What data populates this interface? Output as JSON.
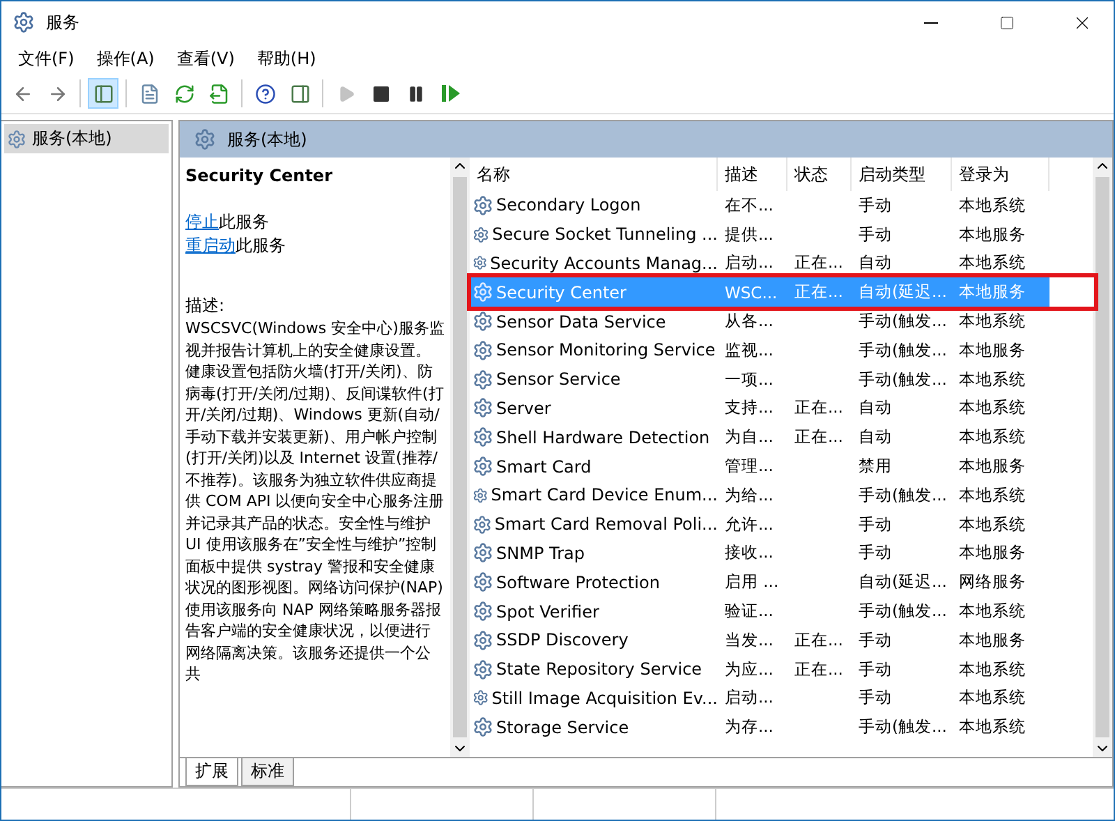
{
  "window": {
    "title": "服务"
  },
  "menu": [
    "文件(F)",
    "操作(A)",
    "查看(V)",
    "帮助(H)"
  ],
  "toolbar": [
    {
      "kind": "back",
      "disabled": false,
      "selected": false
    },
    {
      "kind": "forward",
      "disabled": false,
      "selected": false
    },
    {
      "kind": "tree",
      "disabled": false,
      "selected": true
    },
    {
      "kind": "sheet",
      "disabled": false,
      "selected": false
    },
    {
      "kind": "refresh",
      "disabled": false,
      "selected": false
    },
    {
      "kind": "export",
      "disabled": false,
      "selected": false
    },
    {
      "kind": "help",
      "disabled": false,
      "selected": false
    },
    {
      "kind": "pane",
      "disabled": false,
      "selected": false
    },
    {
      "kind": "play",
      "disabled": true,
      "selected": false
    },
    {
      "kind": "stop",
      "disabled": false,
      "selected": false
    },
    {
      "kind": "pause",
      "disabled": false,
      "selected": false
    },
    {
      "kind": "resume",
      "disabled": false,
      "selected": false
    }
  ],
  "tree": [
    {
      "label": "服务(本地)",
      "selected": true
    }
  ],
  "pane_header": "服务(本地)",
  "details": {
    "title": "Security Center",
    "actions": [
      {
        "link": "停止",
        "text": "此服务"
      },
      {
        "link": "重启动",
        "text": "此服务"
      }
    ],
    "description_label": "描述:",
    "description": "WSCSVC(Windows 安全中心)服务监视并报告计算机上的安全健康设置。健康设置包括防火墙(打开/关闭)、防病毒(打开/关闭/过期)、反间谍软件(打开/关闭/过期)、Windows 更新(自动/手动下载并安装更新)、用户帐户控制(打开/关闭)以及 Internet 设置(推荐/不推荐)。该服务为独立软件供应商提供 COM API 以便向安全中心服务注册并记录其产品的状态。安全性与维护 UI 使用该服务在”安全性与维护”控制面板中提供 systray 警报和安全健康状况的图形视图。网络访问保护(NAP)使用该服务向 NAP 网络策略服务器报告客户端的安全健康状况，以便进行网络隔离决策。该服务还提供一个公共"
  },
  "table": {
    "columns": [
      "名称",
      "描述",
      "状态",
      "启动类型",
      "登录为"
    ],
    "rows": [
      {
        "name": "Secondary Logon",
        "description": "在不...",
        "status": "",
        "startup": "手动",
        "logon": "本地系统",
        "selected": false,
        "outlined": false
      },
      {
        "name": "Secure Socket Tunneling ...",
        "description": "提供...",
        "status": "",
        "startup": "手动",
        "logon": "本地服务",
        "selected": false,
        "outlined": false
      },
      {
        "name": "Security Accounts Manag...",
        "description": "启动...",
        "status": "正在...",
        "startup": "自动",
        "logon": "本地系统",
        "selected": false,
        "outlined": false
      },
      {
        "name": "Security Center",
        "description": "WSC...",
        "status": "正在...",
        "startup": "自动(延迟...",
        "logon": "本地服务",
        "selected": true,
        "outlined": true
      },
      {
        "name": "Sensor Data Service",
        "description": "从各...",
        "status": "",
        "startup": "手动(触发...",
        "logon": "本地系统",
        "selected": false,
        "outlined": false
      },
      {
        "name": "Sensor Monitoring Service",
        "description": "监视...",
        "status": "",
        "startup": "手动(触发...",
        "logon": "本地服务",
        "selected": false,
        "outlined": false
      },
      {
        "name": "Sensor Service",
        "description": "一项...",
        "status": "",
        "startup": "手动(触发...",
        "logon": "本地系统",
        "selected": false,
        "outlined": false
      },
      {
        "name": "Server",
        "description": "支持...",
        "status": "正在...",
        "startup": "自动",
        "logon": "本地系统",
        "selected": false,
        "outlined": false
      },
      {
        "name": "Shell Hardware Detection",
        "description": "为自...",
        "status": "正在...",
        "startup": "自动",
        "logon": "本地系统",
        "selected": false,
        "outlined": false
      },
      {
        "name": "Smart Card",
        "description": "管理...",
        "status": "",
        "startup": "禁用",
        "logon": "本地服务",
        "selected": false,
        "outlined": false
      },
      {
        "name": "Smart Card Device Enum...",
        "description": "为给...",
        "status": "",
        "startup": "手动(触发...",
        "logon": "本地系统",
        "selected": false,
        "outlined": false
      },
      {
        "name": "Smart Card Removal Poli...",
        "description": "允许...",
        "status": "",
        "startup": "手动",
        "logon": "本地系统",
        "selected": false,
        "outlined": false
      },
      {
        "name": "SNMP Trap",
        "description": "接收...",
        "status": "",
        "startup": "手动",
        "logon": "本地服务",
        "selected": false,
        "outlined": false
      },
      {
        "name": "Software Protection",
        "description": "启用 ...",
        "status": "",
        "startup": "自动(延迟...",
        "logon": "网络服务",
        "selected": false,
        "outlined": false
      },
      {
        "name": "Spot Verifier",
        "description": "验证...",
        "status": "",
        "startup": "手动(触发...",
        "logon": "本地系统",
        "selected": false,
        "outlined": false
      },
      {
        "name": "SSDP Discovery",
        "description": "当发...",
        "status": "正在...",
        "startup": "手动",
        "logon": "本地服务",
        "selected": false,
        "outlined": false
      },
      {
        "name": "State Repository Service",
        "description": "为应...",
        "status": "正在...",
        "startup": "手动",
        "logon": "本地系统",
        "selected": false,
        "outlined": false
      },
      {
        "name": "Still Image Acquisition Ev...",
        "description": "启动...",
        "status": "",
        "startup": "手动",
        "logon": "本地系统",
        "selected": false,
        "outlined": false
      },
      {
        "name": "Storage Service",
        "description": "为存...",
        "status": "",
        "startup": "手动(触发...",
        "logon": "本地系统",
        "selected": false,
        "outlined": false
      }
    ]
  },
  "tabs": [
    {
      "label": "扩展",
      "selected": true
    },
    {
      "label": "标准",
      "selected": false
    }
  ]
}
